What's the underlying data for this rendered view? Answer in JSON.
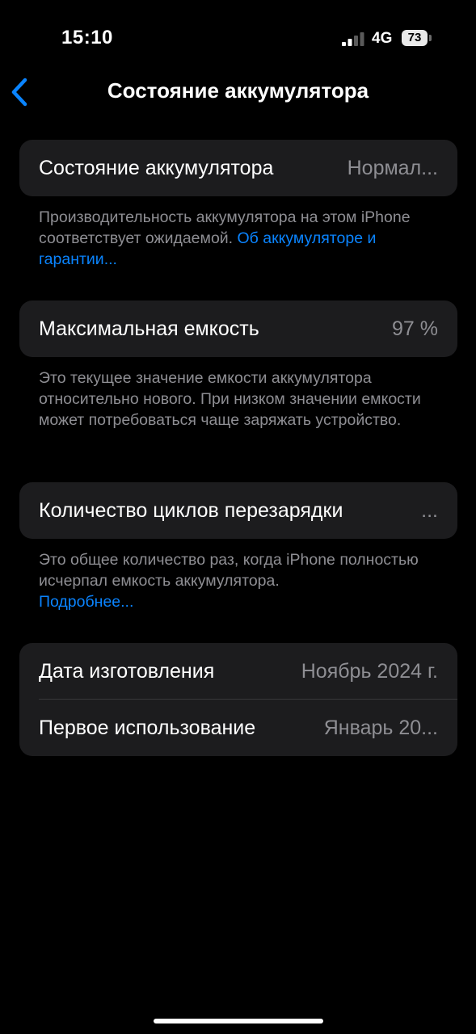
{
  "status_bar": {
    "time": "15:10",
    "network": "4G",
    "battery": "73",
    "icons": [
      "signal-icon",
      "battery-icon"
    ]
  },
  "nav": {
    "back_icon": "chevron-left-icon",
    "title": "Состояние аккумулятора"
  },
  "colors": {
    "background": "#000000",
    "card": "#1c1c1e",
    "secondary_text": "#8e8e93",
    "accent": "#0a84ff"
  },
  "sections": {
    "health": {
      "label": "Состояние аккумулятора",
      "value": "Нормал...",
      "footnote": "Производительность аккумулятора на этом iPhone соответствует ожидаемой.",
      "link": "Об аккумуляторе и гарантии..."
    },
    "capacity": {
      "label": "Максимальная емкость",
      "value": "97 %",
      "footnote": "Это текущее значение емкости аккумулятора относительно нового. При низком значении емкости может потребоваться чаще заряжать устройство."
    },
    "cycles": {
      "label": "Количество циклов перезарядки",
      "value": "...",
      "footnote": "Это общее количество раз, когда iPhone полностью исчерпал емкость аккумулятора.",
      "link": "Подробнее..."
    },
    "dates": {
      "manufacture_label": "Дата изготовления",
      "manufacture_value": "Ноябрь 2024 г.",
      "first_use_label": "Первое использование",
      "first_use_value": "Январь 20..."
    }
  }
}
